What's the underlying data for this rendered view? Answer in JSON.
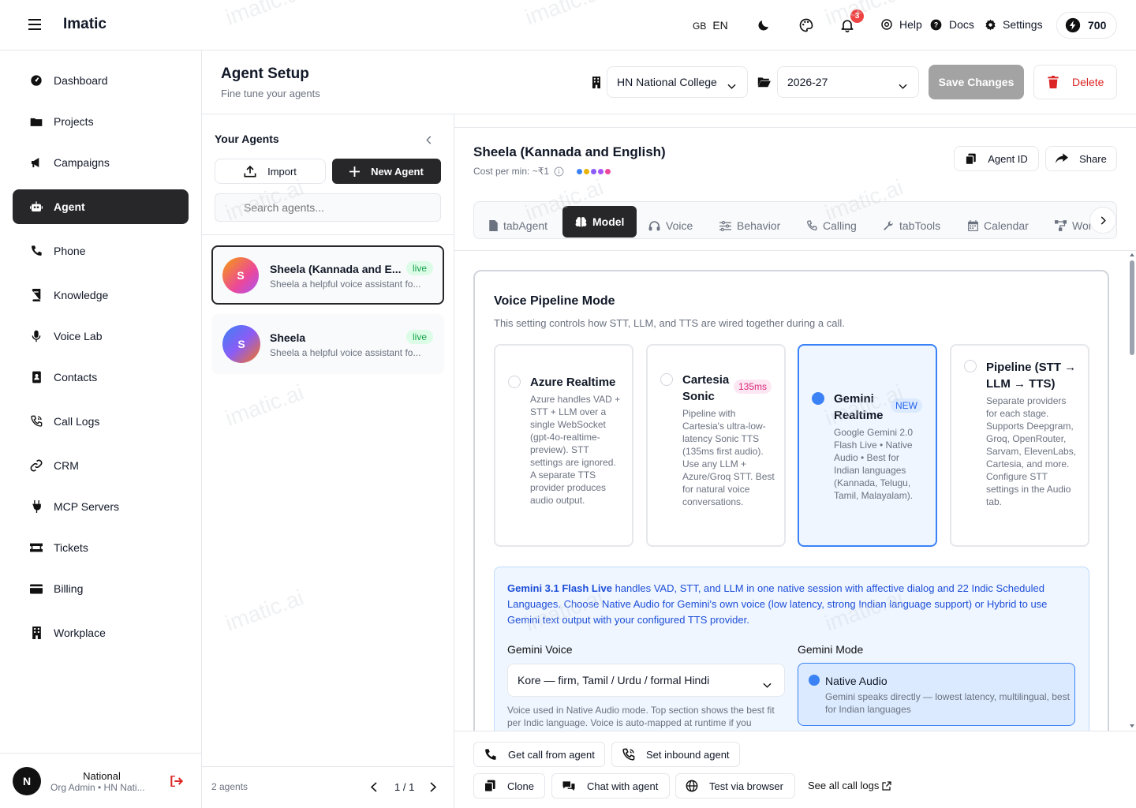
{
  "app": {
    "name": "Imatic"
  },
  "header": {
    "lang_flag": "GB",
    "lang_code": "EN",
    "notifications_count": "3",
    "help": "Help",
    "docs": "Docs",
    "settings": "Settings",
    "credits": "700"
  },
  "sidebar": {
    "items": [
      {
        "label": "Dashboard",
        "icon": "dashboard-icon"
      },
      {
        "label": "Projects",
        "icon": "folder-icon"
      },
      {
        "label": "Campaigns",
        "icon": "megaphone-icon"
      },
      {
        "label": "Agent",
        "icon": "robot-icon",
        "active": true
      },
      {
        "label": "Phone",
        "icon": "phone-icon"
      },
      {
        "label": "Knowledge",
        "icon": "book-icon"
      },
      {
        "label": "Voice Lab",
        "icon": "mic-icon"
      },
      {
        "label": "Contacts",
        "icon": "contacts-icon"
      },
      {
        "label": "Call Logs",
        "icon": "call-log-icon"
      },
      {
        "label": "CRM",
        "icon": "link-icon"
      },
      {
        "label": "MCP Servers",
        "icon": "plug-icon"
      },
      {
        "label": "Tickets",
        "icon": "ticket-icon"
      },
      {
        "label": "Billing",
        "icon": "card-icon"
      },
      {
        "label": "Workplace",
        "icon": "building-icon"
      }
    ],
    "user": {
      "initial": "N",
      "name": "National",
      "subtitle": "Org Admin • HN Nati..."
    }
  },
  "page": {
    "title": "Agent Setup",
    "subtitle": "Fine tune your agents",
    "org_select": "HN National College",
    "year_select": "2026-27",
    "save_label": "Save Changes",
    "delete_label": "Delete"
  },
  "agents_panel": {
    "title": "Your Agents",
    "import_label": "Import",
    "new_label": "New Agent",
    "search_placeholder": "Search agents...",
    "agents": [
      {
        "initial": "S",
        "name": "Sheela (Kannada and E...",
        "desc": "Sheela a helpful voice assistant fo...",
        "status": "live",
        "selected": true
      },
      {
        "initial": "S",
        "name": "Sheela",
        "desc": "Sheela a helpful voice assistant fo...",
        "status": "live",
        "selected": false
      }
    ],
    "count_label": "2 agents",
    "pager": "1 / 1"
  },
  "agent_detail": {
    "name": "Sheela (Kannada and English)",
    "cost": "Cost per min: ~₹1",
    "agent_id_label": "Agent ID",
    "share_label": "Share",
    "dot_colors": [
      "#3b82f6",
      "#eab308",
      "#8b5cf6",
      "#a855f7",
      "#ec4899"
    ],
    "tabs": [
      {
        "label": "tabAgent",
        "icon": "file-icon"
      },
      {
        "label": "Model",
        "icon": "brain-icon",
        "active": true
      },
      {
        "label": "Voice",
        "icon": "headphones-icon"
      },
      {
        "label": "Behavior",
        "icon": "sliders-icon"
      },
      {
        "label": "Calling",
        "icon": "phone-call-icon"
      },
      {
        "label": "tabTools",
        "icon": "wrench-icon"
      },
      {
        "label": "Calendar",
        "icon": "calendar-icon"
      },
      {
        "label": "Wor",
        "icon": "workflow-icon"
      }
    ]
  },
  "pipeline": {
    "title": "Voice Pipeline Mode",
    "description": "This setting controls how STT, LLM, and TTS are wired together during a call.",
    "options": [
      {
        "title": "Azure Realtime",
        "badge": "",
        "desc": "Azure handles VAD + STT + LLM over a single WebSocket (gpt-4o-realtime-preview). STT settings are ignored. A separate TTS provider produces audio output.",
        "selected": false
      },
      {
        "title": "Cartesia Sonic",
        "badge": "135ms",
        "desc": "Pipeline with Cartesia's ultra-low-latency Sonic TTS (135ms first audio). Use any LLM + Azure/Groq STT. Best for natural voice conversations.",
        "selected": false
      },
      {
        "title": "Gemini Realtime",
        "badge": "NEW",
        "desc": "Google Gemini 2.0 Flash Live • Native Audio • Best for Indian languages (Kannada, Telugu, Tamil, Malayalam).",
        "selected": true
      },
      {
        "title": "Pipeline (STT → LLM → TTS)",
        "badge": "",
        "desc": "Separate providers for each stage. Supports Deepgram, Groq, OpenRouter, Sarvam, ElevenLabs, Cartesia, and more. Configure STT settings in the Audio tab.",
        "selected": false
      }
    ]
  },
  "gemini": {
    "info_bold": "Gemini 3.1 Flash Live",
    "info_text": " handles VAD, STT, and LLM in one native session with affective dialog and 22 Indic Scheduled Languages. Choose Native Audio for Gemini's own voice (low latency, strong Indian language support) or Hybrid to use Gemini text output with your configured TTS provider.",
    "voice_label": "Gemini Voice",
    "voice_value": "Kore — firm, Tamil / Urdu / formal Hindi",
    "voice_help": "Voice used in Native Audio mode. Top section shows the best fit per Indic language. Voice is auto-mapped at runtime if you",
    "mode_label": "Gemini Mode",
    "mode_title": "Native Audio",
    "mode_desc": "Gemini speaks directly — lowest latency, multilingual, best for Indian languages"
  },
  "footer_actions": {
    "get_call": "Get call from agent",
    "inbound": "Set inbound agent",
    "clone": "Clone",
    "chat": "Chat with agent",
    "test": "Test via browser",
    "logs": "See all call logs"
  },
  "watermark": "imatic.ai"
}
